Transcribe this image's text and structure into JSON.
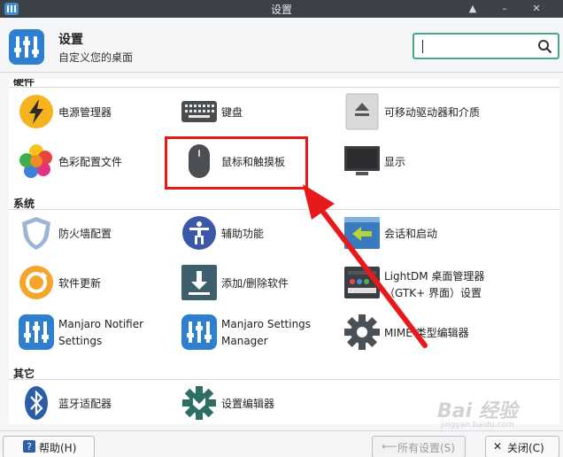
{
  "window": {
    "title": "设置",
    "controls": [
      "▲",
      "–",
      "✕"
    ]
  },
  "header": {
    "title": "设置",
    "subtitle": "自定义您的桌面",
    "search_placeholder": ""
  },
  "categories": [
    {
      "name": "硬件",
      "items": [
        {
          "label": "电源管理器",
          "icon": "power-icon"
        },
        {
          "label": "键盘",
          "icon": "keyboard-icon"
        },
        {
          "label": "可移动驱动器和介质",
          "icon": "eject-drive-icon"
        },
        {
          "label": "色彩配置文件",
          "icon": "color-profile-icon"
        },
        {
          "label": "鼠标和触摸板",
          "icon": "mouse-icon"
        },
        {
          "label": "显示",
          "icon": "display-icon"
        }
      ]
    },
    {
      "name": "系统",
      "items": [
        {
          "label": "防火墙配置",
          "icon": "shield-icon"
        },
        {
          "label": "辅助功能",
          "icon": "accessibility-icon"
        },
        {
          "label": "会话和启动",
          "icon": "session-icon"
        },
        {
          "label": "软件更新",
          "icon": "update-icon"
        },
        {
          "label": "添加/删除软件",
          "icon": "download-icon"
        },
        {
          "label": "LightDM 桌面管理器",
          "label2": "（GTK+ 界面）设置",
          "icon": "lightdm-icon"
        },
        {
          "label": "Manjaro Notifier",
          "label2": "Settings",
          "icon": "manjaro-icon"
        },
        {
          "label": "Manjaro Settings",
          "label2": "Manager",
          "icon": "manjaro-icon"
        },
        {
          "label": "MIME 类型编辑器",
          "icon": "gear-icon"
        }
      ]
    },
    {
      "name": "其它",
      "items": [
        {
          "label": "蓝牙适配器",
          "icon": "bluetooth-icon"
        },
        {
          "label": "设置编辑器",
          "icon": "settings-editor-icon"
        }
      ]
    }
  ],
  "bottom": {
    "help_label": "帮助(H)",
    "all_settings_label": "所有设置(S)",
    "close_label": "关闭(C)"
  },
  "watermark": {
    "text": "Bai 经验",
    "subtext": "jingyan.baidu.com"
  },
  "colors": {
    "accent": "#4aa58f",
    "highlight": "#e8191c",
    "titlebar": "#3c4148"
  }
}
